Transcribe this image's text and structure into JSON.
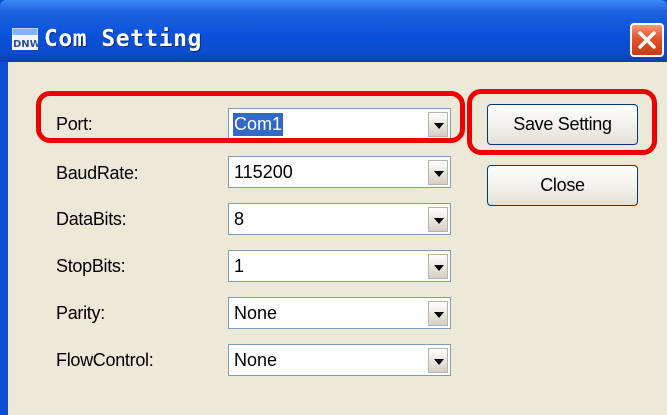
{
  "window": {
    "title": "Com Setting",
    "app_icon": "dnw-app-icon",
    "close_icon": "close-x-icon"
  },
  "fields": [
    {
      "label": "Port:",
      "value": "Com1",
      "selected": true
    },
    {
      "label": "BaudRate:",
      "value": "115200",
      "selected": false
    },
    {
      "label": "DataBits:",
      "value": "8",
      "selected": false
    },
    {
      "label": "StopBits:",
      "value": "1",
      "selected": false
    },
    {
      "label": "Parity:",
      "value": "None",
      "selected": false
    },
    {
      "label": "FlowControl:",
      "value": "None",
      "selected": false
    }
  ],
  "buttons": {
    "save_label": "Save Setting",
    "close_label": "Close"
  },
  "colors": {
    "titlebar": "#0a52da",
    "client_bg": "#ece9d8",
    "selection": "#316ac5",
    "highlight": "#ee0000"
  }
}
